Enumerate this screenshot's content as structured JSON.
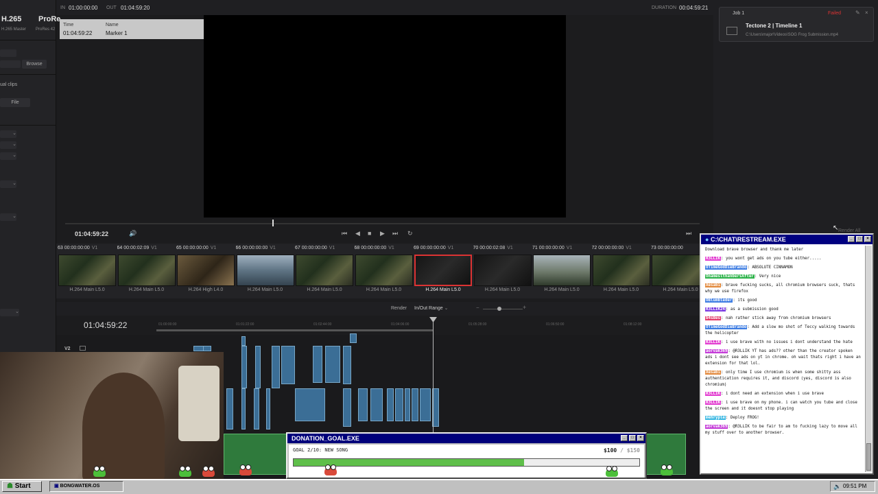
{
  "left_panel": {
    "codec_1": "H.265",
    "codec_2": "ProRe",
    "codec_1_sub": "H.265 Master",
    "codec_2_sub": "ProRes 42",
    "browse_label": "Browse",
    "clips_text": "ual clips",
    "file_text": "File"
  },
  "viewer": {
    "in_label": "IN",
    "in_value": "01:00:00:00",
    "out_label": "OUT",
    "out_value": "01:04:59:20",
    "duration_label": "DURATION",
    "duration_value": "00:04:59:21",
    "marker": {
      "time_header": "Time",
      "name_header": "Name",
      "time_value": "01:04:59:22",
      "name_value": "Marker 1"
    },
    "current_tc": "01:04:59:22",
    "playhead_fraction": 0.34
  },
  "clips": [
    {
      "num": "63",
      "tc": "00:00:00:00",
      "track": "V1",
      "label": "H.264 Main L5.0",
      "thumb": "jungle"
    },
    {
      "num": "64",
      "tc": "00:00:02:09",
      "track": "V1",
      "label": "H.264 Main L5.0",
      "thumb": "jungle"
    },
    {
      "num": "65",
      "tc": "00:00:00:00",
      "track": "V1",
      "label": "H.264 High L4.0",
      "thumb": "indoor"
    },
    {
      "num": "66",
      "tc": "00:00:00:00",
      "track": "V1",
      "label": "H.264 Main L5.0",
      "thumb": "water"
    },
    {
      "num": "67",
      "tc": "00:00:00:00",
      "track": "V1",
      "label": "H.264 Main L5.0",
      "thumb": "jungle"
    },
    {
      "num": "68",
      "tc": "00:00:00:00",
      "track": "V1",
      "label": "H.264 Main L5.0",
      "thumb": "jungle"
    },
    {
      "num": "69",
      "tc": "00:00:00:00",
      "track": "V1",
      "label": "H.264 Main L5.0",
      "thumb": "dark",
      "selected": true
    },
    {
      "num": "70",
      "tc": "00:00:02:08",
      "track": "V1",
      "label": "H.264 Main L5.0",
      "thumb": "dark"
    },
    {
      "num": "71",
      "tc": "00:00:00:00",
      "track": "V1",
      "label": "H.264 Main L5.0",
      "thumb": "sky"
    },
    {
      "num": "72",
      "tc": "00:00:00:00",
      "track": "V1",
      "label": "H.264 Main L5.0",
      "thumb": "jungle"
    },
    {
      "num": "73",
      "tc": "00:00:00:00",
      "track": "",
      "label": "H.264 Main L5.0",
      "thumb": "jungle"
    }
  ],
  "timeline": {
    "render_label": "Render",
    "range_label": "In/Out Range",
    "timecode": "01:04:59:22",
    "track_label": "V2",
    "ruler_ticks": [
      "01:00:00:00",
      "01:01:22:00",
      "01:02:44:00",
      "01:04:06:00",
      "01:05:28:00",
      "01:06:50:00",
      "01:08:12:00"
    ]
  },
  "render_queue": {
    "job_title": "Job 1",
    "job_status": "Failed",
    "job_name": "Tectone 2 | Timeline 1",
    "job_path": "C:\\Users\\major\\Videos\\SOG Frog Submission.mp4",
    "render_all": "Render All"
  },
  "chat": {
    "title": "C:\\CHAT\\RESTREAM.EXE",
    "messages": [
      {
        "user": "",
        "color": "#999999",
        "text": "Download brave browser and thank me later"
      },
      {
        "user": "R3LLIK",
        "color": "#e23bd0",
        "text": "you wont get ads on you tube either....."
      },
      {
        "user": "OTimeGodDieBrando",
        "color": "#3b7be2",
        "text": "ABSOLUTE CINNAMON"
      },
      {
        "user": "OnameslthanbersAfter",
        "color": "#2db34a",
        "text": "Very nice"
      },
      {
        "user": "Aesabi",
        "color": "#e2883b",
        "text": "brave fucking sucks, all chromium browsers suck, thats why we use firefox"
      },
      {
        "user": "OBlumbleder",
        "color": "#3b7be2",
        "text": "its good"
      },
      {
        "user": "R3LLIK24",
        "color": "#7b3be2",
        "text": "as a submission good"
      },
      {
        "user": "b4sBes",
        "color": "#e23b6a",
        "text": "nah rather stick away from chromium browsers"
      },
      {
        "user": "OTimeGodDieBrando",
        "color": "#3b7be2",
        "text": "Add a slow mo shot of Teccy walking towards the helicopter"
      },
      {
        "user": "R3LLIK",
        "color": "#e23bd0",
        "text": "i use brave with no issues i dont understand the hate"
      },
      {
        "user": "aorvak369",
        "color": "#c43bd8",
        "text": "@R3LLIK YT has ads?? other than the creator spoken ads i dont see ads on yt in chrome. oh wait thats right i have an extension for that lol."
      },
      {
        "user": "Aesabi",
        "color": "#e2883b",
        "text": "only time I use chromium is when some shitty ass authentication requires it, and discord (yes, discord is also chromium)"
      },
      {
        "user": "R3LLIK",
        "color": "#e23bd0",
        "text": "i dont need an extension when i use brave"
      },
      {
        "user": "R3LLIK",
        "color": "#e23bd0",
        "text": "i use brave on my phone. i can watch you tube and close the screen and it doesnt stop playing"
      },
      {
        "user": "mehryple",
        "color": "#3bb8e2",
        "text": "Deploy FROG!"
      },
      {
        "user": "aorvak369",
        "color": "#c43bd8",
        "text": "@R3LLIK to be fair to am to fucking lazy to move all my stuff over to another browser."
      }
    ]
  },
  "donation": {
    "title": "DONATION_GOAL.EXE",
    "goal_text": "GOAL 2/10: NEW SONG",
    "current": "$100",
    "separator": "/",
    "target": "$150",
    "progress_fraction": 0.667
  },
  "taskbar": {
    "start_label": "Start",
    "task_label": "BONGWATER.OS",
    "clock": "09:51 PM"
  },
  "colors": {
    "accent_blue": "#000080",
    "clip_select": "#dd3333",
    "timeline_video": "#3b6e96",
    "timeline_audio": "#2f7a3c"
  }
}
